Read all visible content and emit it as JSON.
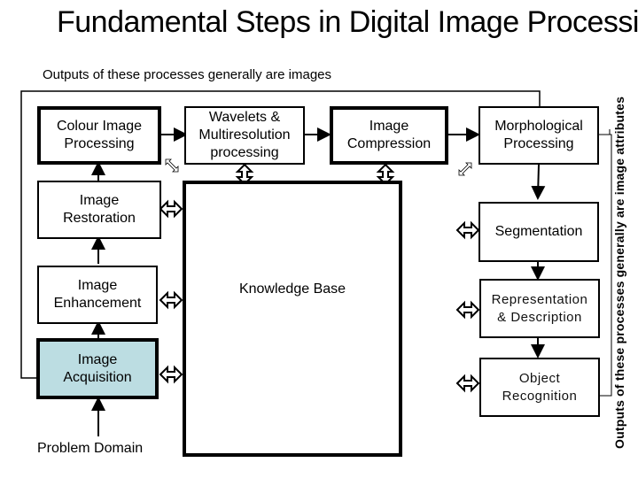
{
  "title": "Fundamental Steps in Digital Image Processing:",
  "subtitle": "Outputs of these processes generally are images",
  "side_label": "Outputs of these processes generally are image attributes",
  "boxes": {
    "colour": "Colour Image\nProcessing",
    "wavelets": "Wavelets &\nMultiresolution\nprocessing",
    "compression": "Image\nCompression",
    "morphological": "Morphological\nProcessing",
    "restoration": "Image\nRestoration",
    "segmentation": "Segmentation",
    "enhancement": "Image\nEnhancement",
    "representation": "Representation\n& Description",
    "acquisition": "Image\nAcquisition",
    "recognition": "Object\nRecognition"
  },
  "knowledge_base": "Knowledge Base",
  "problem_domain": "Problem Domain",
  "colors": {
    "acquisition_fill": "#bcdde2"
  }
}
